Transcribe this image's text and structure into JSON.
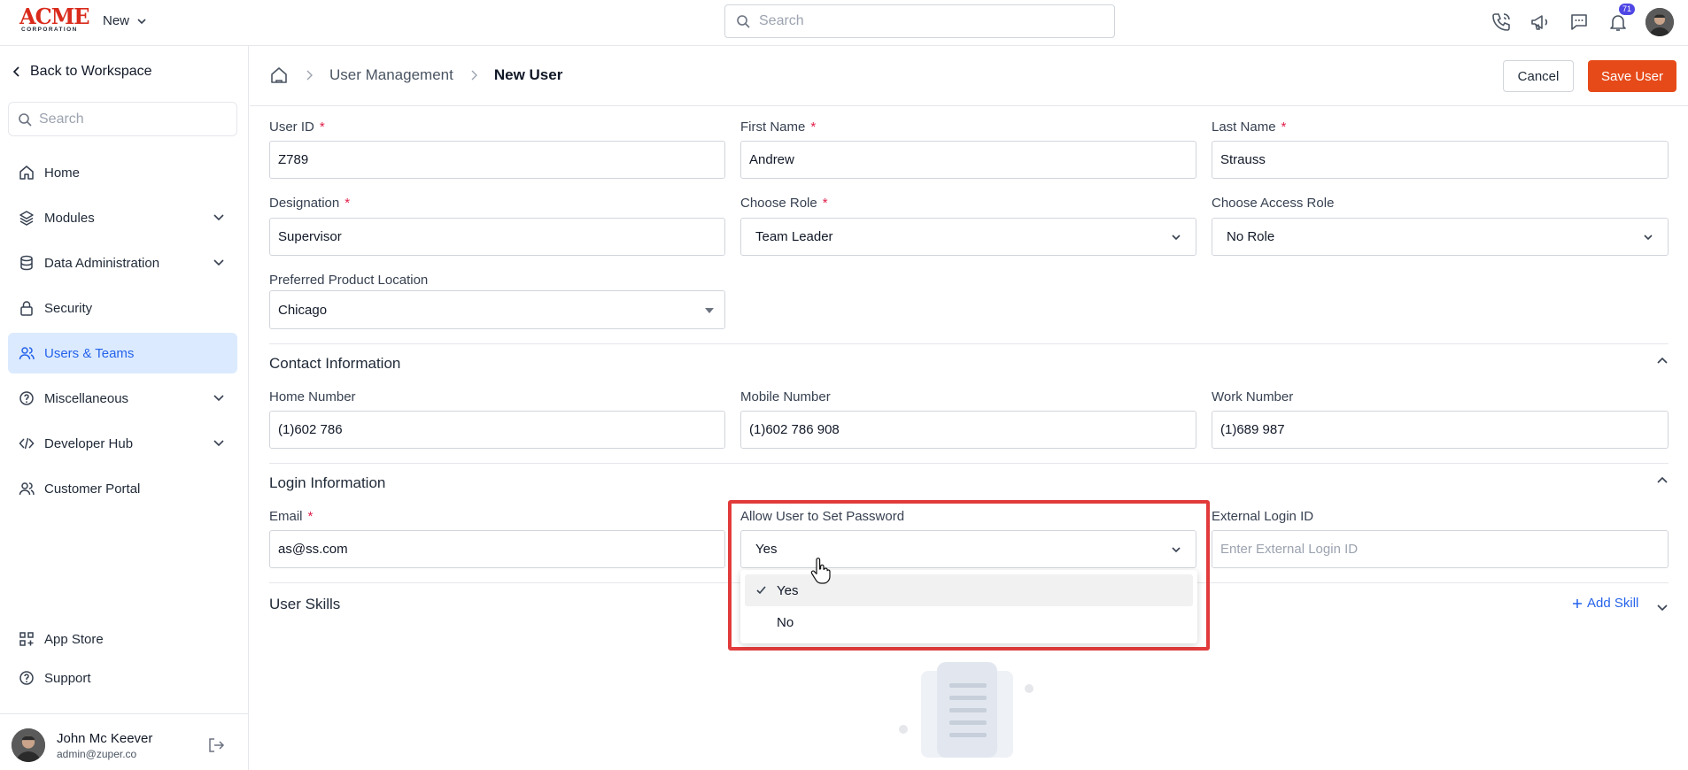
{
  "app": {
    "logo_word": "ACME",
    "logo_sub": "CORPORATION",
    "new_menu": "New",
    "search_placeholder": "Search",
    "notification_count": "71"
  },
  "sidebar": {
    "back_label": "Back to Workspace",
    "search_placeholder": "Search",
    "items": [
      {
        "label": "Home",
        "icon": "home-icon"
      },
      {
        "label": "Modules",
        "icon": "layers-icon"
      },
      {
        "label": "Data Administration",
        "icon": "database-icon"
      },
      {
        "label": "Security",
        "icon": "lock-icon"
      },
      {
        "label": "Users & Teams",
        "icon": "users-icon"
      },
      {
        "label": "Miscellaneous",
        "icon": "help-circle-icon"
      },
      {
        "label": "Developer Hub",
        "icon": "code-icon"
      },
      {
        "label": "Customer Portal",
        "icon": "user-group-icon"
      }
    ],
    "bottom_items": [
      {
        "label": "App Store",
        "icon": "grid-icon"
      },
      {
        "label": "Support",
        "icon": "help-icon"
      }
    ],
    "user": {
      "name": "John Mc Keever",
      "email": "admin@zuper.co"
    }
  },
  "header": {
    "breadcrumb": [
      "User Management",
      "New User"
    ],
    "cancel_label": "Cancel",
    "save_label": "Save User"
  },
  "form": {
    "user_id": {
      "label": "User ID",
      "value": "Z789"
    },
    "first_name": {
      "label": "First Name",
      "value": "Andrew"
    },
    "last_name": {
      "label": "Last Name",
      "value": "Strauss"
    },
    "designation": {
      "label": "Designation",
      "value": "Supervisor"
    },
    "role": {
      "label": "Choose Role",
      "value": "Team Leader"
    },
    "access_role": {
      "label": "Choose Access Role",
      "value": "No Role"
    },
    "location": {
      "label": "Preferred Product Location",
      "value": "Chicago"
    },
    "contact": {
      "title": "Contact Information",
      "home": {
        "label": "Home Number",
        "value": "(1)602 786"
      },
      "mobile": {
        "label": "Mobile Number",
        "value": "(1)602 786 908"
      },
      "work": {
        "label": "Work Number",
        "value": "(1)689 987"
      }
    },
    "login": {
      "title": "Login Information",
      "email": {
        "label": "Email",
        "value": "as@ss.com"
      },
      "allow_password": {
        "label": "Allow User to Set Password",
        "value": "Yes",
        "options": [
          "Yes",
          "No"
        ]
      },
      "external_id": {
        "label": "External Login ID",
        "placeholder": "Enter External Login ID"
      }
    },
    "skills": {
      "title": "User Skills",
      "add_label": "Add Skill"
    }
  },
  "colors": {
    "accent": "#e64a19",
    "active_nav": "#dbeafe",
    "link": "#2563eb",
    "highlight": "#e23b3b"
  }
}
